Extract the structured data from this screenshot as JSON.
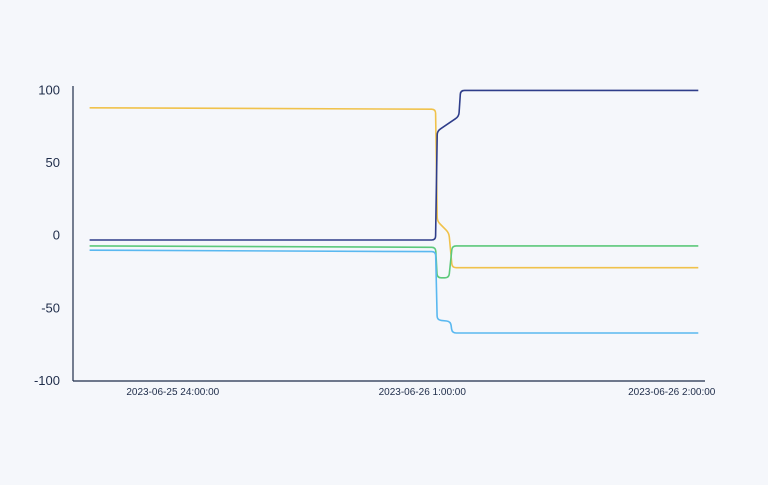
{
  "chart_data": {
    "type": "line",
    "title": "",
    "xlabel": "",
    "ylabel": "",
    "grid": false,
    "legend": "none",
    "x_ticks": [
      {
        "x": 0.25,
        "label": "2023-06-25  24:00:00"
      },
      {
        "x": 1.0,
        "label": "2023-06-26  1:00:00"
      },
      {
        "x": 1.75,
        "label": "2023-06-26  2:00:00"
      }
    ],
    "y_ticks": [
      {
        "y": 100,
        "label": "100"
      },
      {
        "y": 50,
        "label": "50"
      },
      {
        "y": 0,
        "label": "0"
      },
      {
        "y": -50,
        "label": "-50"
      },
      {
        "y": -100,
        "label": "-100"
      }
    ],
    "xlim": [
      -0.05,
      1.85
    ],
    "ylim": [
      -100,
      103
    ],
    "series": [
      {
        "color": "#f0c24b",
        "points": [
          [
            0,
            88
          ],
          [
            1.04,
            87
          ],
          [
            1.045,
            10
          ],
          [
            1.08,
            2
          ],
          [
            1.09,
            -22
          ],
          [
            1.83,
            -22
          ]
        ]
      },
      {
        "color": "#2e3d8a",
        "points": [
          [
            0,
            -3
          ],
          [
            1.04,
            -3
          ],
          [
            1.045,
            72
          ],
          [
            1.11,
            82
          ],
          [
            1.115,
            100
          ],
          [
            1.83,
            100
          ]
        ]
      },
      {
        "color": "#5cc97b",
        "points": [
          [
            0,
            -7
          ],
          [
            1.04,
            -8
          ],
          [
            1.045,
            -29
          ],
          [
            1.08,
            -29
          ],
          [
            1.09,
            -7
          ],
          [
            1.83,
            -7
          ]
        ]
      },
      {
        "color": "#59b8f0",
        "points": [
          [
            0,
            -10
          ],
          [
            1.04,
            -11
          ],
          [
            1.045,
            -58
          ],
          [
            1.085,
            -59
          ],
          [
            1.09,
            -67
          ],
          [
            1.83,
            -67
          ]
        ]
      }
    ]
  }
}
